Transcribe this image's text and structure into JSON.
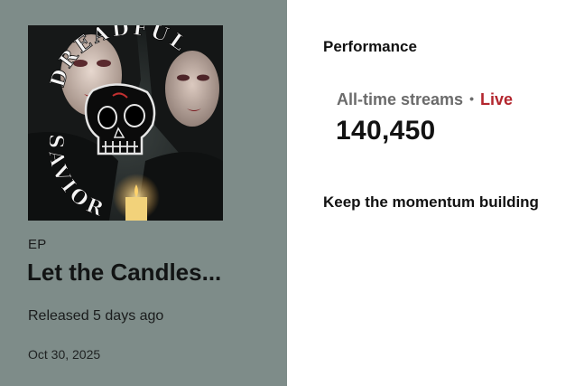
{
  "release": {
    "cover_alt_text": "DREADFUL SAVIOR",
    "type": "EP",
    "title": "Let the Candles...",
    "status": "Released 5 days ago",
    "date": "Oct 30, 2025"
  },
  "performance": {
    "heading": "Performance",
    "streams_label": "All-time streams",
    "separator": "•",
    "live_label": "Live",
    "streams_value": "140,450",
    "momentum_text": "Keep the momentum building"
  },
  "colors": {
    "left_panel_bg": "#7e8c89",
    "live_red": "#b3262e",
    "label_gray": "#6b6b6b",
    "text_dark": "#121212"
  }
}
